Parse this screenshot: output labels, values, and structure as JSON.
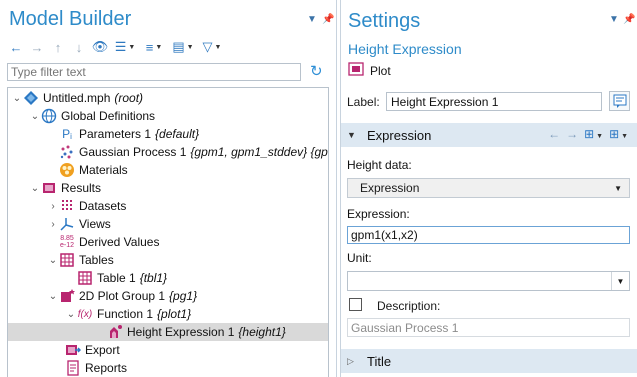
{
  "model_builder": {
    "title": "Model Builder",
    "filter_placeholder": "Type filter text",
    "tree": [
      {
        "label": "Untitled.mph",
        "tag": "(root)"
      },
      {
        "label": "Global Definitions",
        "tag": ""
      },
      {
        "label": "Parameters 1",
        "tag": "{default}"
      },
      {
        "label": "Gaussian Process 1",
        "tag": "{gpm1, gpm1_stddev} {gp"
      },
      {
        "label": "Materials",
        "tag": ""
      },
      {
        "label": "Results",
        "tag": ""
      },
      {
        "label": "Datasets",
        "tag": ""
      },
      {
        "label": "Views",
        "tag": ""
      },
      {
        "label": "Derived Values",
        "tag": ""
      },
      {
        "label": "Tables",
        "tag": ""
      },
      {
        "label": "Table 1",
        "tag": "{tbl1}"
      },
      {
        "label": "2D Plot Group 1",
        "tag": "{pg1}"
      },
      {
        "label": "Function 1",
        "tag": "{plot1}"
      },
      {
        "label": "Height Expression 1",
        "tag": "{height1}"
      },
      {
        "label": "Export",
        "tag": ""
      },
      {
        "label": "Reports",
        "tag": ""
      }
    ],
    "derived_values_icon_text": [
      "8.85",
      "e-12"
    ],
    "parameters_icon_text": "P",
    "function_icon_text": "f(x)"
  },
  "settings": {
    "title": "Settings",
    "node_title": "Height Expression",
    "node_type": "Plot",
    "label_caption": "Label:",
    "label_value": "Height Expression 1",
    "expression_section": "Expression",
    "height_data_caption": "Height data:",
    "height_data_value": "Expression",
    "expression_caption": "Expression:",
    "expression_value": "gpm1(x1,x2)",
    "unit_caption": "Unit:",
    "unit_value": "",
    "description_caption": "Description:",
    "description_value": "Gaussian Process 1",
    "title_section": "Title"
  },
  "colors": {
    "accent": "#2e8bc9",
    "section_bg": "#dde8f2",
    "selected_row": "#d9d9d9"
  }
}
